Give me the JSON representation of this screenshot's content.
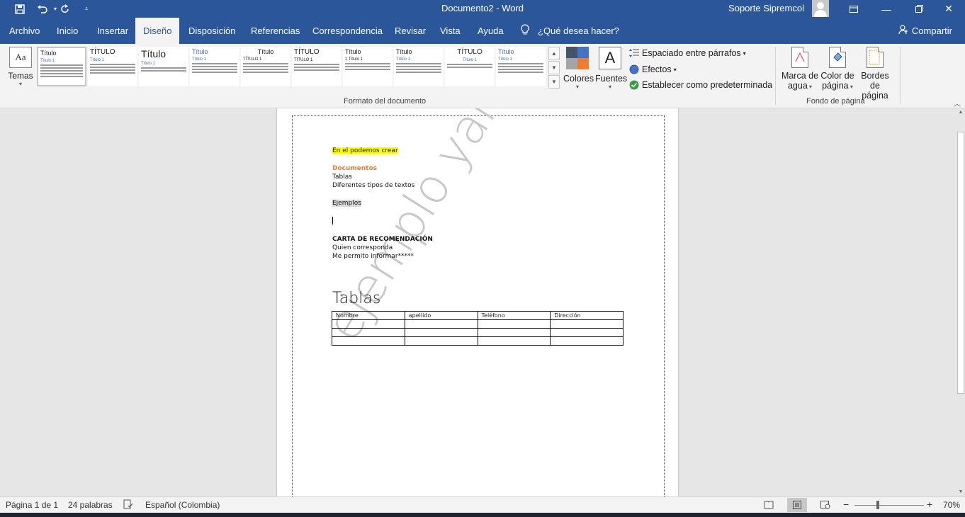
{
  "titlebar": {
    "title": "Documento2  -  Word",
    "user": "Soporte Sipremcol",
    "save_icon": "save-icon",
    "undo_icon": "undo-icon",
    "redo_icon": "redo-icon"
  },
  "tabs": [
    {
      "label": "Archivo",
      "active": false
    },
    {
      "label": "Inicio",
      "active": false
    },
    {
      "label": "Insertar",
      "active": false
    },
    {
      "label": "Diseño",
      "active": true
    },
    {
      "label": "Disposición",
      "active": false
    },
    {
      "label": "Referencias",
      "active": false
    },
    {
      "label": "Correspondencia",
      "active": false
    },
    {
      "label": "Revisar",
      "active": false
    },
    {
      "label": "Vista",
      "active": false
    },
    {
      "label": "Ayuda",
      "active": false
    }
  ],
  "tell_me": "¿Qué desea hacer?",
  "share": "Compartir",
  "ribbon": {
    "temas": "Temas",
    "temas_icon_text": "Aa",
    "gallery": [
      {
        "title": "Título",
        "sub": "Título 1"
      },
      {
        "title": "TÍTULO",
        "sub": "Título 1"
      },
      {
        "title": "Título",
        "sub": "Título 1"
      },
      {
        "title": "Título",
        "sub": "Título 1"
      },
      {
        "title": "Título",
        "sub": "TÍTULO 1"
      },
      {
        "title": "TÍTULO",
        "sub": "TÍTULO 1"
      },
      {
        "title": "Título",
        "sub": "1  Título 1"
      },
      {
        "title": "Título",
        "sub": "Título 1"
      },
      {
        "title": "TÍTULO",
        "sub": "Título 1"
      },
      {
        "title": "Título",
        "sub": "Título 1"
      }
    ],
    "colors_label": "Colores",
    "fonts_label": "Fuentes",
    "fonts_icon_text": "A",
    "paragraph_spacing": "Espaciado entre párrafos",
    "effects": "Efectos",
    "set_default": "Establecer como predeterminada",
    "group_format": "Formato del documento",
    "watermark_l1": "Marca de",
    "watermark_l2": "agua",
    "page_color_l1": "Color de",
    "page_color_l2": "página",
    "page_borders_l1": "Bordes",
    "page_borders_l2": "de página",
    "group_background": "Fondo de página",
    "accent_colors": [
      "#44546a",
      "#4472c4",
      "#a5a5a5",
      "#ed7d31"
    ]
  },
  "document": {
    "line1": "En el podemos crear",
    "line2": "Documentos",
    "line3": " Tablas",
    "line4": "Diferentes tipos de textos",
    "line5": "Ejemplos",
    "carta_title": "CARTA DE RECOMENDACIÓN",
    "carta_line1": "Quien corresponda",
    "carta_line2": "Me permito informar*****",
    "tablas_heading": "Tablas",
    "table_headers": [
      "Nombre",
      "apellido",
      "Teléfono",
      "Dirección"
    ],
    "watermark": "ejemplo yaireth"
  },
  "status": {
    "page": "Página 1 de 1",
    "words": "24 palabras",
    "language": "Español (Colombia)",
    "zoom": "70%",
    "zoom_minus": "−",
    "zoom_plus": "+"
  }
}
